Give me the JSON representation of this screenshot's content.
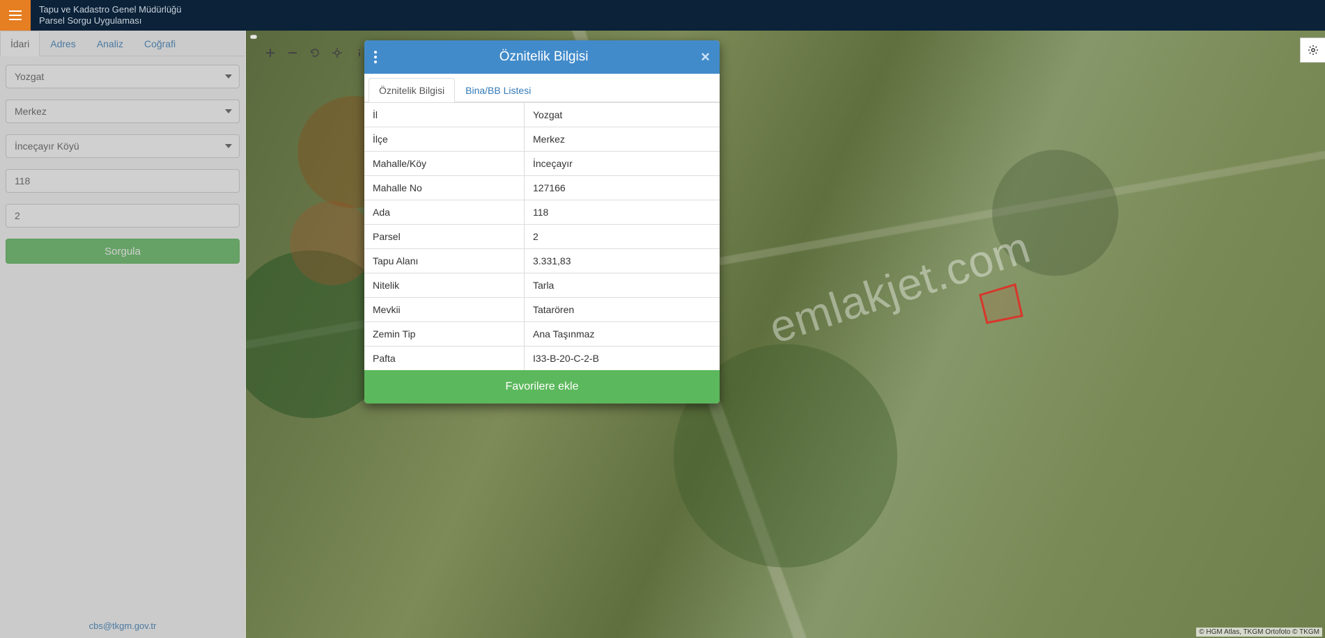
{
  "header": {
    "title1": "Tapu ve Kadastro Genel Müdürlüğü",
    "title2": "Parsel Sorgu Uygulaması"
  },
  "sidebar": {
    "tabs": [
      "İdari",
      "Adres",
      "Analiz",
      "Coğrafi"
    ],
    "active_tab": 0,
    "form": {
      "il": "Yozgat",
      "ilce": "Merkez",
      "mahalle": "İnceçayır Köyü",
      "ada": "118",
      "parsel": "2"
    },
    "query_button": "Sorgula",
    "footer_email": "cbs@tkgm.gov.tr"
  },
  "map": {
    "attribution": "© HGM Atlas, TKGM Ortofoto © TKGM",
    "watermark": "emlakjet.com"
  },
  "modal": {
    "title": "Öznitelik Bilgisi",
    "tabs": [
      "Öznitelik Bilgisi",
      "Bina/BB Listesi"
    ],
    "active_tab": 0,
    "rows": [
      {
        "label": "İl",
        "value": "Yozgat"
      },
      {
        "label": "İlçe",
        "value": "Merkez"
      },
      {
        "label": "Mahalle/Köy",
        "value": "İnceçayır"
      },
      {
        "label": "Mahalle No",
        "value": "127166"
      },
      {
        "label": "Ada",
        "value": "118"
      },
      {
        "label": "Parsel",
        "value": "2"
      },
      {
        "label": "Tapu Alanı",
        "value": "3.331,83"
      },
      {
        "label": "Nitelik",
        "value": "Tarla"
      },
      {
        "label": "Mevkii",
        "value": "Tatarören"
      },
      {
        "label": "Zemin Tip",
        "value": "Ana Taşınmaz"
      },
      {
        "label": "Pafta",
        "value": "I33-B-20-C-2-B"
      }
    ],
    "favorite_button": "Favorilere ekle"
  }
}
